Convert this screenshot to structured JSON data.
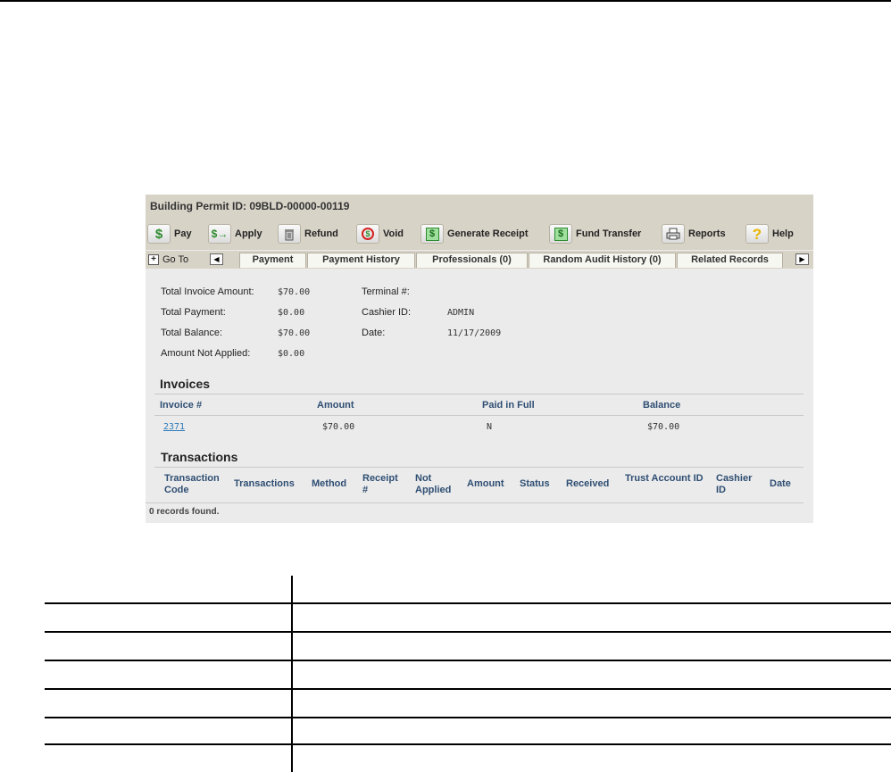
{
  "header": {
    "title": "Building Permit ID: 09BLD-00000-00119"
  },
  "toolbar": {
    "buttons": [
      {
        "label": "Pay",
        "icon": "dollar-icon"
      },
      {
        "label": "Apply",
        "icon": "dollar-arrow-icon"
      },
      {
        "label": "Refund",
        "icon": "trash-icon"
      },
      {
        "label": "Void",
        "icon": "void-icon"
      },
      {
        "label": "Generate Receipt",
        "icon": "receipt-icon"
      },
      {
        "label": "Fund Transfer",
        "icon": "fund-transfer-icon"
      },
      {
        "label": "Reports",
        "icon": "printer-icon"
      },
      {
        "label": "Help",
        "icon": "help-icon"
      }
    ]
  },
  "tabs": {
    "goto": "Go To",
    "items": [
      "Payment",
      "Payment History",
      "Professionals (0)",
      "Random Audit History (0)",
      "Related Records"
    ]
  },
  "summary": {
    "total_invoice_amount_label": "Total Invoice Amount:",
    "total_invoice_amount": "$70.00",
    "total_payment_label": "Total Payment:",
    "total_payment": "$0.00",
    "total_balance_label": "Total Balance:",
    "total_balance": "$70.00",
    "amount_not_applied_label": "Amount Not Applied:",
    "amount_not_applied": "$0.00",
    "terminal_label": "Terminal #:",
    "terminal": "",
    "cashier_label": "Cashier ID:",
    "cashier": "ADMIN",
    "date_label": "Date:",
    "date": "11/17/2009"
  },
  "invoices": {
    "title": "Invoices",
    "headers": [
      "Invoice #",
      "Amount",
      "Paid in Full",
      "Balance"
    ],
    "rows": [
      {
        "invoice": "2371",
        "amount": "$70.00",
        "paid_in_full": "N",
        "balance": "$70.00"
      }
    ]
  },
  "transactions": {
    "title": "Transactions",
    "headers": [
      "Transaction Code",
      "Transactions",
      "Method",
      "Receipt #",
      "Not Applied",
      "Amount",
      "Status",
      "Received",
      "Trust Account ID",
      "Cashier ID",
      "Date"
    ],
    "empty_message": "0 records found."
  }
}
